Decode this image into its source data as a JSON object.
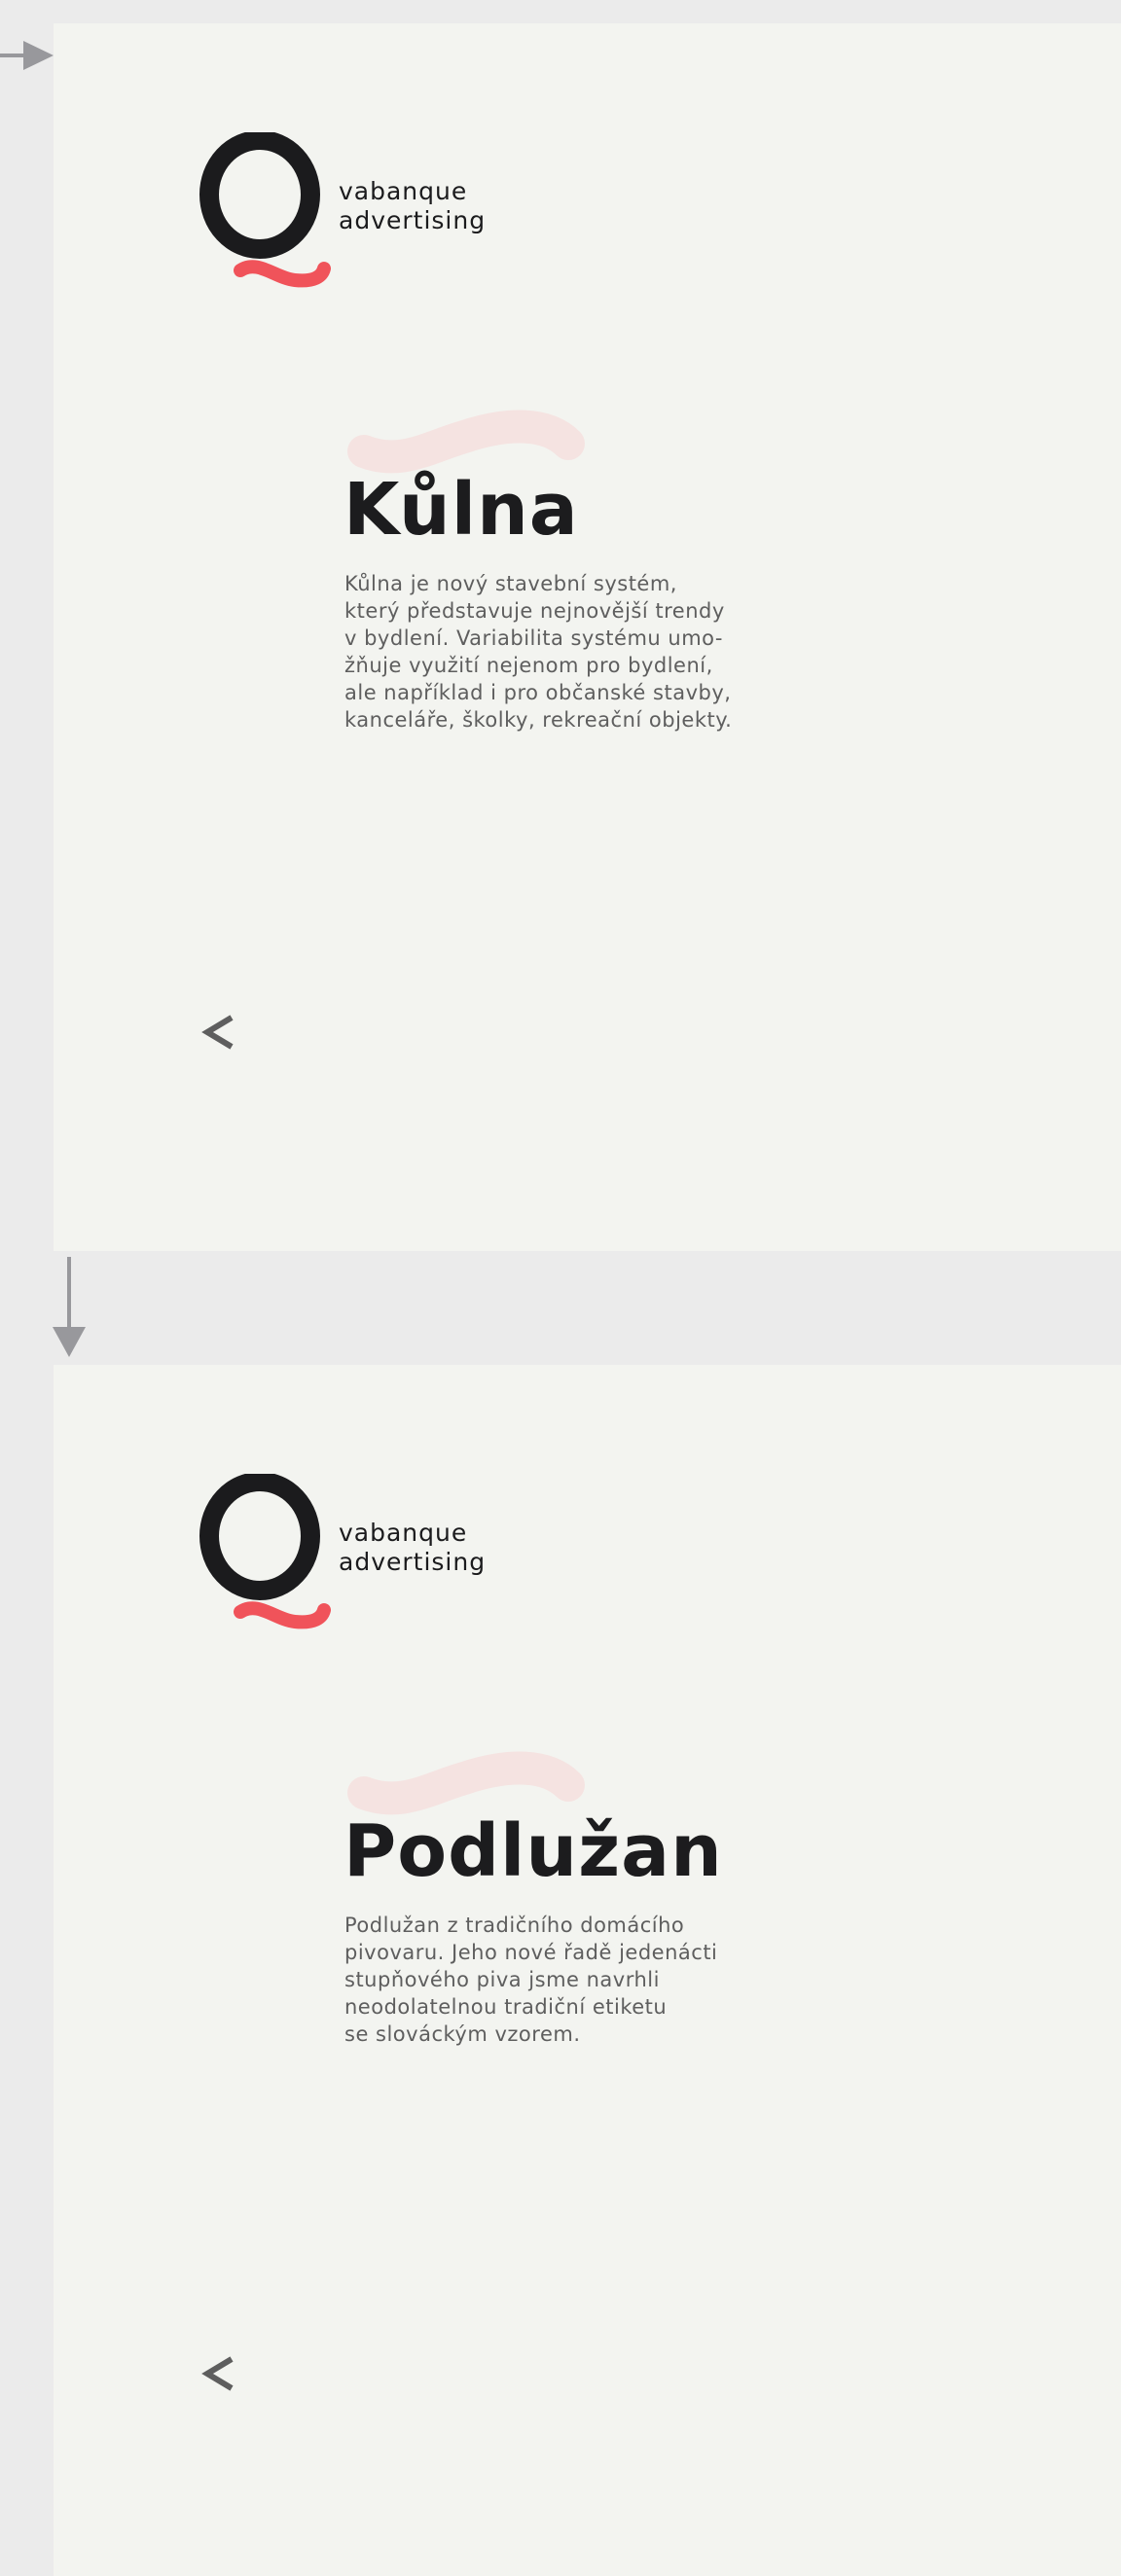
{
  "colors": {
    "page_background": "#ebebeb",
    "panel_background": "#f3f4f0",
    "logo_dark": "#1b1b1d",
    "logo_accent": "#f0535a",
    "swoosh": "#f5e3e1",
    "arrow": "#98989c",
    "body_text": "#5e5e5e",
    "title_text": "#1c1c1e"
  },
  "slides": [
    {
      "logo": {
        "icon": "q-logo-icon",
        "line1": "vabanque",
        "line2": "advertising"
      },
      "title": "Kůlna",
      "description_lines": [
        "Kůlna je nový stavební systém,",
        "který představuje nejnovější trendy",
        "v bydlení. Variabilita systému umo-",
        "žňuje využití nejenom pro bydlení,",
        "ale například i pro občanské stavby,",
        "kanceláře, školky, rekreační objekty."
      ],
      "prev_icon": "chevron-left-icon"
    },
    {
      "logo": {
        "icon": "q-logo-icon",
        "line1": "vabanque",
        "line2": "advertising"
      },
      "title": "Podlužan",
      "description_lines": [
        "Podlužan z tradičního domácího",
        "pivovaru. Jeho nové řadě jedenácti",
        "stupňového piva jsme navrhli",
        "neodolatelnou tradiční etiketu",
        "se slováckým vzorem."
      ],
      "prev_icon": "chevron-left-icon"
    }
  ],
  "flow_arrows": [
    {
      "icon": "arrow-right-icon"
    },
    {
      "icon": "arrow-down-icon"
    }
  ]
}
